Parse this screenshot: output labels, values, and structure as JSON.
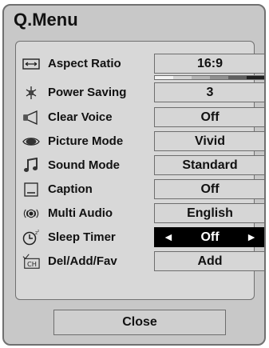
{
  "title": "Q.Menu",
  "items": [
    {
      "label": "Aspect Ratio",
      "value": "16:9",
      "icon": "aspect-ratio-icon"
    },
    {
      "label": "Power Saving",
      "value": "3",
      "icon": "power-saving-icon",
      "level_segments": 6,
      "level": 3
    },
    {
      "label": "Clear Voice",
      "value": "Off",
      "icon": "speaker-icon"
    },
    {
      "label": "Picture Mode",
      "value": "Vivid",
      "icon": "eye-icon"
    },
    {
      "label": "Sound Mode",
      "value": "Standard",
      "icon": "music-note-icon"
    },
    {
      "label": "Caption",
      "value": "Off",
      "icon": "caption-icon"
    },
    {
      "label": "Multi Audio",
      "value": "English",
      "icon": "multi-audio-icon"
    },
    {
      "label": "Sleep Timer",
      "value": "Off",
      "icon": "sleep-timer-icon",
      "selected": true,
      "arrow_left": "◄",
      "arrow_right": "►"
    },
    {
      "label": "Del/Add/Fav",
      "value": "Add",
      "icon": "channel-icon",
      "icon_text": "CH"
    }
  ],
  "close_label": "Close",
  "colors": {
    "selected_bg": "#000000",
    "selected_fg": "#ffffff",
    "value_bg": "#d6d6d6"
  }
}
